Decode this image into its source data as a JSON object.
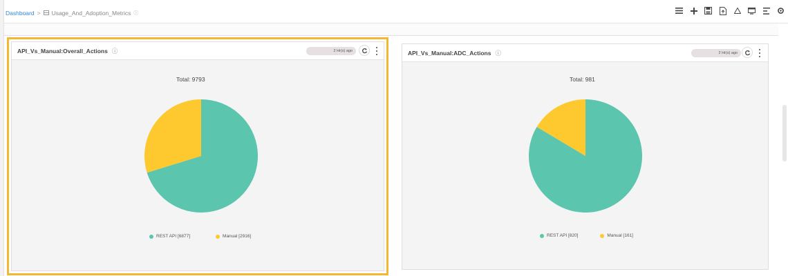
{
  "breadcrumb": {
    "root": "Dashboard",
    "separator": ">",
    "dashboard_name": "Usage_And_Adoption_Metrics",
    "info_glyph": "ⓘ",
    "icon": "dashboard-grid-icon"
  },
  "toolbar": {
    "icons": [
      "list-icon",
      "add-icon",
      "save-icon",
      "export-icon",
      "alert-icon",
      "display-icon",
      "filter-icon",
      "settings-icon"
    ]
  },
  "widgets": [
    {
      "title": "API_Vs_Manual:Overall_Actions",
      "info_glyph": "ⓘ",
      "updated": "2 Hr(s) ago",
      "selected": true,
      "total_label": "Total: 9793",
      "legend": [
        "REST API [6877]",
        "Manual [2916]"
      ]
    },
    {
      "title": "API_Vs_Manual:ADC_Actions",
      "info_glyph": "ⓘ",
      "updated": "2 Hr(s) ago",
      "selected": false,
      "total_label": "Total: 981",
      "legend": [
        "REST API [820]",
        "Manual [161]"
      ]
    }
  ],
  "colors": {
    "rest_api": "#5cc5ae",
    "manual": "#fec92f",
    "selection_border": "#f4b731",
    "link": "#2f86d1"
  },
  "chart_data": [
    {
      "type": "pie",
      "title": "API_Vs_Manual:Overall_Actions",
      "total": 9793,
      "categories": [
        "REST API",
        "Manual"
      ],
      "values": [
        6877,
        2916
      ],
      "colors": [
        "#5cc5ae",
        "#fec92f"
      ],
      "legend_position": "bottom"
    },
    {
      "type": "pie",
      "title": "API_Vs_Manual:ADC_Actions",
      "total": 981,
      "categories": [
        "REST API",
        "Manual"
      ],
      "values": [
        820,
        161
      ],
      "colors": [
        "#5cc5ae",
        "#fec92f"
      ],
      "legend_position": "bottom"
    }
  ]
}
